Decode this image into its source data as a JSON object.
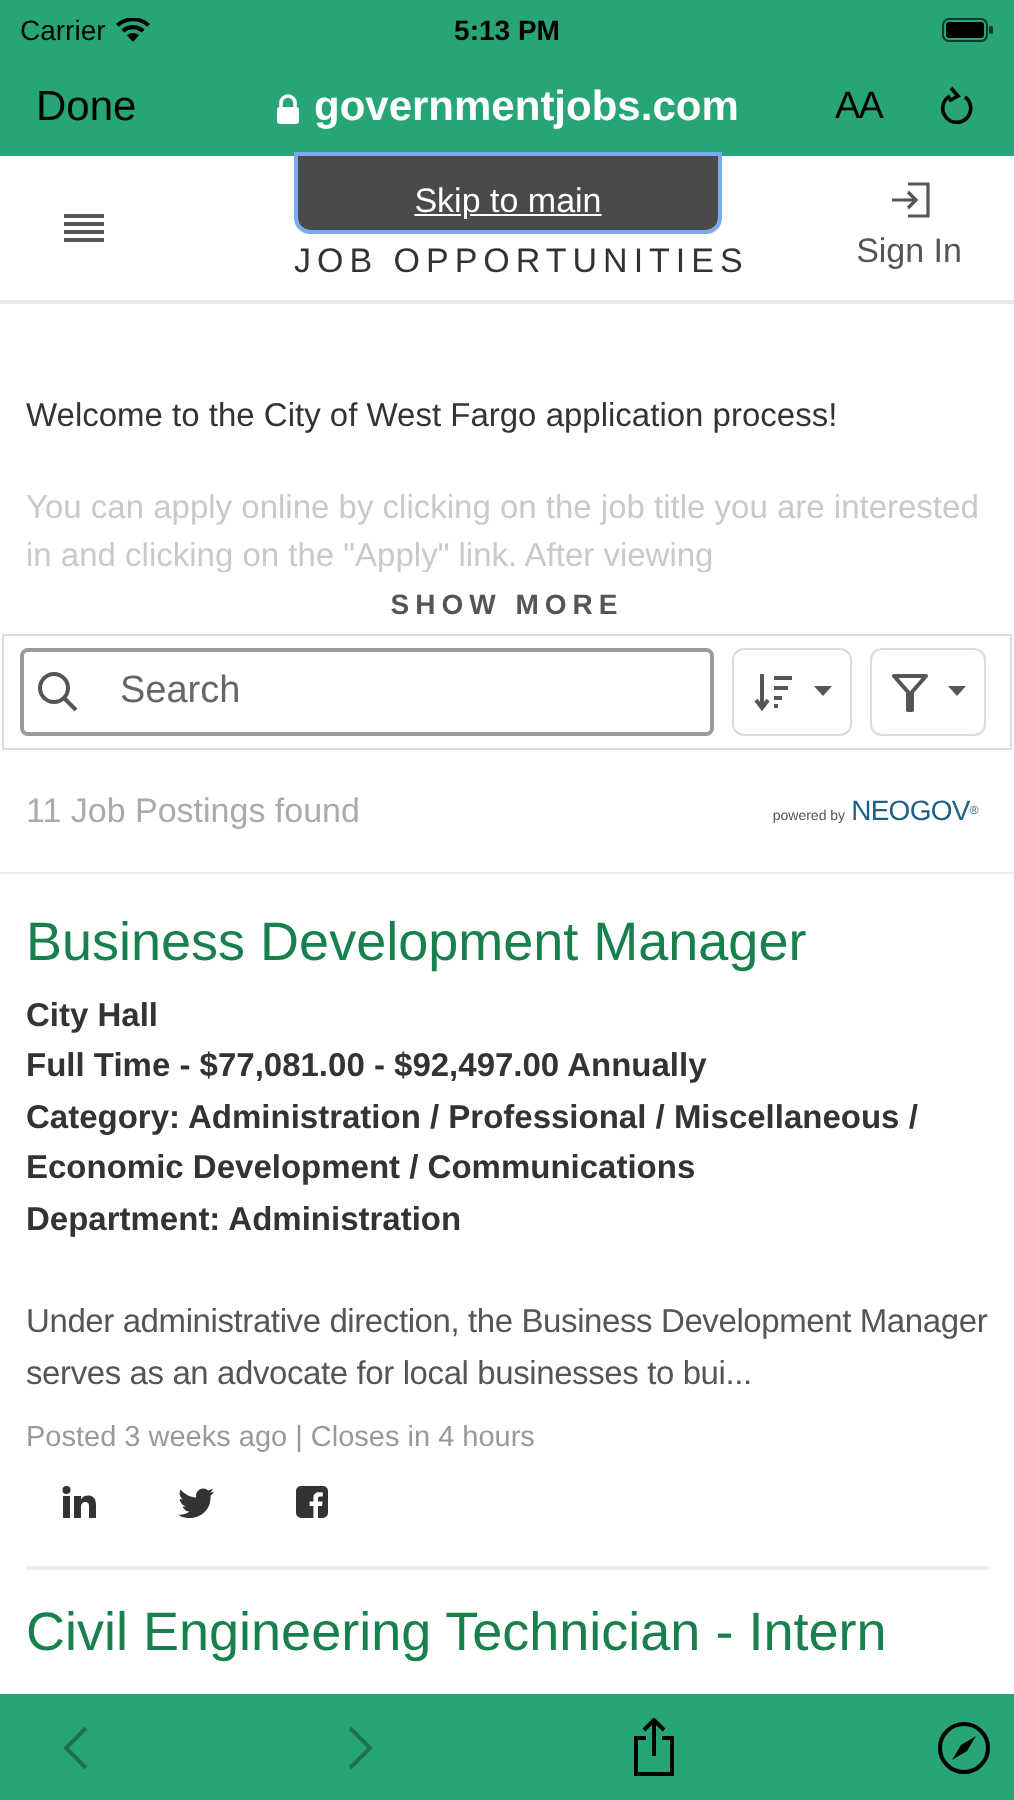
{
  "status_bar": {
    "carrier": "Carrier",
    "time": "5:13 PM"
  },
  "browser_bar": {
    "done": "Done",
    "url": "governmentjobs.com",
    "text_size": "AA"
  },
  "header": {
    "title": "JOB OPPORTUNITIES",
    "skip_link": "Skip to main",
    "sign_in": "Sign In"
  },
  "intro": {
    "welcome": "Welcome to the City of West Fargo application process!",
    "details": "You can apply online by clicking on the job title you are interested in and clicking on the \"Apply\" link. After viewing",
    "show_more": "SHOW MORE"
  },
  "search": {
    "placeholder": "Search"
  },
  "results": {
    "count": "11 Job Postings found",
    "powered_by": "powered by",
    "brand": "NEOGOV",
    "brand_mark": "®"
  },
  "jobs": [
    {
      "title": "Business Development Manager",
      "details": [
        "City Hall",
        "Full Time - $77,081.00 - $92,497.00 Annually",
        "Category: Administration / Professional / Miscellaneous / Economic Development / Communications",
        "Department: Administration"
      ],
      "description": "Under administrative direction, the Business Development Manager serves as an advocate for local businesses to bui...",
      "posted": "Posted 3 weeks ago | Closes in 4 hours",
      "share": true
    },
    {
      "title": "Civil Engineering Technician - Intern",
      "share": false
    }
  ]
}
